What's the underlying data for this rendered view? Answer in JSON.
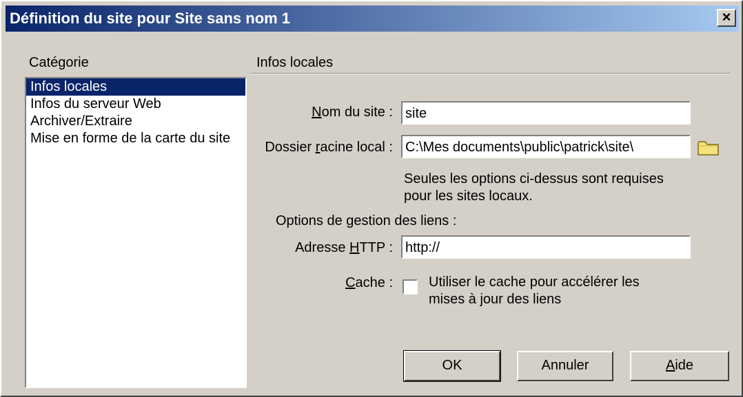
{
  "window": {
    "title": "Définition du site pour  Site sans nom 1",
    "close_glyph": "×"
  },
  "sidebar": {
    "label": "Catégorie",
    "items": [
      {
        "label": "Infos locales",
        "selected": true
      },
      {
        "label": "Infos du serveur Web"
      },
      {
        "label": "Archiver/Extraire"
      },
      {
        "label": "Mise en forme de la carte du site"
      }
    ]
  },
  "main": {
    "section_title": "Infos locales",
    "site_name": {
      "label_pre": "",
      "label_u": "N",
      "label_post": "om du site :",
      "value": "site"
    },
    "root_folder": {
      "label_pre": "Dossier ",
      "label_u": "r",
      "label_post": "acine local :",
      "value": "C:\\Mes documents\\public\\patrick\\site\\",
      "icon": "folder-icon"
    },
    "note_line1": "Seules les options ci-dessus sont requises",
    "note_line2": "pour les sites locaux.",
    "links_label": "Options de gestion des liens :",
    "http": {
      "label_pre": "Adresse ",
      "label_u": "H",
      "label_post": "TTP :",
      "value": "http://"
    },
    "cache": {
      "label_u": "C",
      "label_post": "ache :",
      "line1": "Utiliser le cache pour accélérer les",
      "line2": "mises à jour des liens",
      "checked": false
    }
  },
  "buttons": {
    "ok": "OK",
    "cancel": "Annuler",
    "help_u": "A",
    "help_post": "ide"
  },
  "colors": {
    "titlebar_start": "#0a246a",
    "titlebar_end": "#a6caf0",
    "selection": "#0a246a",
    "face": "#d4d0c8"
  }
}
